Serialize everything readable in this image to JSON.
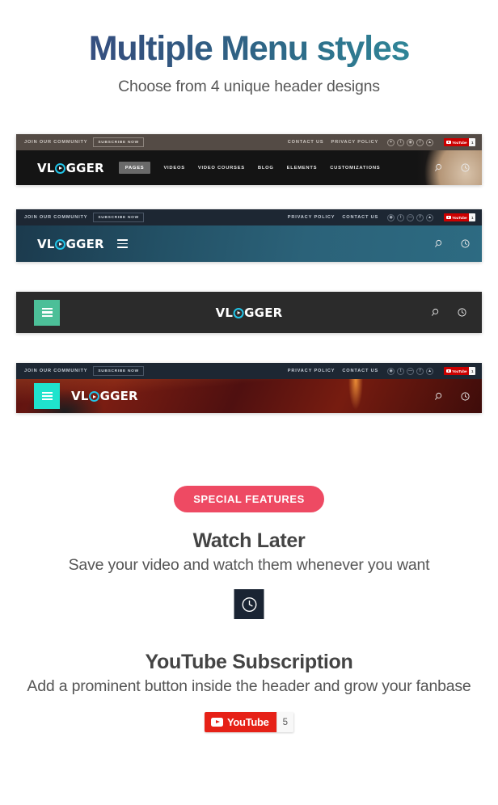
{
  "hero": {
    "title": "Multiple Menu styles",
    "subtitle": "Choose from 4 unique header designs"
  },
  "colors": {
    "title_gradient_start": "#3a4a85",
    "title_gradient_end": "#338fa0",
    "badge_pink": "#ee4a63",
    "hamburger_green": "#4cbf98",
    "hamburger_cyan": "#1fe3cd",
    "logo_accent_cyan": "#22c4e8",
    "youtube_red": "#e62117",
    "clock_tile_navy": "#1a2433"
  },
  "headers": [
    {
      "id": "header-style-1",
      "topbar": {
        "join_label": "JOIN OUR COMMUNITY",
        "subscribe_label": "SUBSCRIBE NOW",
        "links": [
          "CONTACT US",
          "PRIVACY POLICY"
        ],
        "socials": [
          "twitter-icon",
          "tumblr-icon",
          "instagram-icon",
          "facebook-icon",
          "linkedin-icon"
        ],
        "youtube": {
          "label": "YouTube",
          "count": "1"
        }
      },
      "logo": {
        "pre": "VL",
        "post": "GGER"
      },
      "nav": [
        "PAGES",
        "VIDEOS",
        "VIDEO COURSES",
        "BLOG",
        "ELEMENTS",
        "CUSTOMIZATIONS"
      ],
      "active_nav": "PAGES",
      "icons": [
        "search-icon",
        "watch-later-clock-icon"
      ]
    },
    {
      "id": "header-style-2",
      "topbar": {
        "join_label": "JOIN OUR COMMUNITY",
        "subscribe_label": "SUBSCRIBE NOW",
        "links": [
          "PRIVACY POLICY",
          "CONTACT US"
        ],
        "socials": [
          "instagram-icon",
          "tumblr-icon",
          "dribbble-icon",
          "facebook-icon",
          "linkedin-icon"
        ],
        "youtube": {
          "label": "YouTube",
          "count": "1"
        }
      },
      "logo": {
        "pre": "VL",
        "post": "GGER"
      },
      "icons": [
        "search-icon",
        "watch-later-clock-icon"
      ]
    },
    {
      "id": "header-style-3",
      "logo": {
        "pre": "VL",
        "post": "GGER"
      },
      "icons": [
        "search-icon",
        "watch-later-clock-icon"
      ]
    },
    {
      "id": "header-style-4",
      "topbar": {
        "join_label": "JOIN OUR COMMUNITY",
        "subscribe_label": "SUBSCRIBE NOW",
        "links": [
          "PRIVACY POLICY",
          "CONTACT US"
        ],
        "socials": [
          "instagram-icon",
          "tumblr-icon",
          "dribbble-icon",
          "facebook-icon",
          "linkedin-icon"
        ],
        "youtube": {
          "label": "YouTube",
          "count": "1"
        }
      },
      "logo": {
        "pre": "VL",
        "post": "GGER"
      },
      "icons": [
        "search-icon",
        "watch-later-clock-icon"
      ]
    }
  ],
  "features": {
    "badge": "SPECIAL FEATURES",
    "items": [
      {
        "title": "Watch Later",
        "description": "Save your video and watch them whenever you want",
        "icon": "clock-icon"
      },
      {
        "title": "YouTube Subscription",
        "description": "Add a prominent button inside the header and grow your fanbase",
        "icon": "youtube-icon"
      }
    ]
  },
  "youtube_button": {
    "label": "YouTube",
    "count": "5"
  }
}
